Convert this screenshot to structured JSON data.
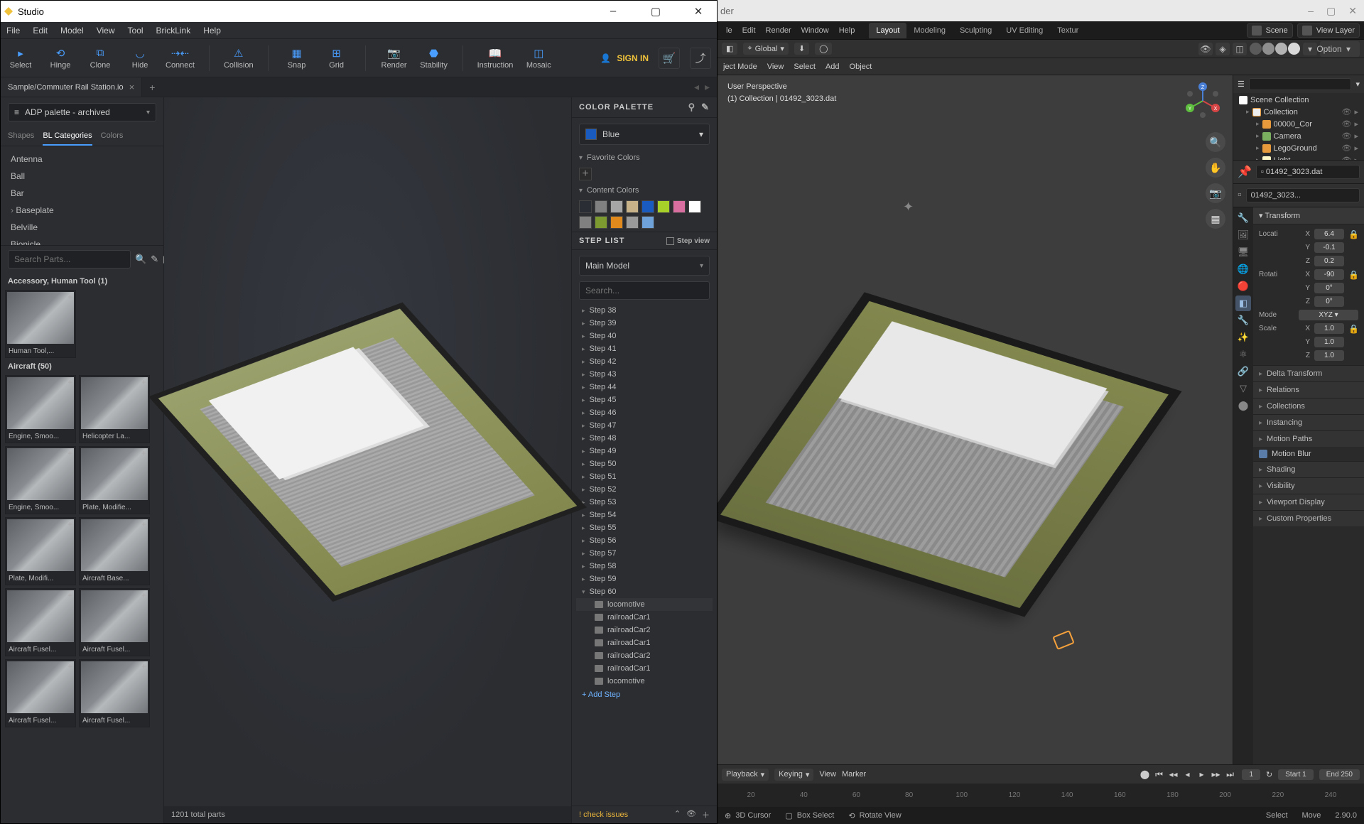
{
  "studio": {
    "title": "Studio",
    "menus": [
      "File",
      "Edit",
      "Model",
      "View",
      "Tool",
      "BrickLink",
      "Help"
    ],
    "toolbar": [
      {
        "id": "select",
        "label": "Select"
      },
      {
        "id": "hinge",
        "label": "Hinge"
      },
      {
        "id": "clone",
        "label": "Clone"
      },
      {
        "id": "hide",
        "label": "Hide"
      },
      {
        "id": "connect",
        "label": "Connect"
      },
      {
        "id": "collision",
        "label": "Collision"
      },
      {
        "id": "snap",
        "label": "Snap"
      },
      {
        "id": "grid",
        "label": "Grid"
      },
      {
        "id": "render",
        "label": "Render"
      },
      {
        "id": "stability",
        "label": "Stability"
      },
      {
        "id": "instruction",
        "label": "Instruction"
      },
      {
        "id": "mosaic",
        "label": "Mosaic"
      }
    ],
    "signin": "SIGN IN",
    "file_tab": "Sample/Commuter Rail Station.io",
    "palette": "ADP palette - archived",
    "cat_tabs": [
      "Shapes",
      "BL Categories",
      "Colors"
    ],
    "cat_tabs_active": 1,
    "categories": [
      "Antenna",
      "Ball",
      "Bar",
      "Baseplate",
      "Belville",
      "Bionicle"
    ],
    "search_placeholder": "Search Parts...",
    "sections": [
      {
        "title": "Accessory, Human Tool (1)",
        "items": [
          "Human Tool,..."
        ]
      },
      {
        "title": "Aircraft (50)",
        "items": [
          "Engine, Smoo...",
          "Helicopter La...",
          "Engine, Smoo...",
          "Plate, Modifie...",
          "Plate, Modifi...",
          "Aircraft Base...",
          "Aircraft Fusel...",
          "Aircraft Fusel...",
          "Aircraft Fusel...",
          "Aircraft Fusel..."
        ]
      }
    ],
    "status": "1201 total parts",
    "color_palette_hdr": "COLOR PALETTE",
    "current_color": {
      "name": "Blue",
      "hex": "#1a5bbf"
    },
    "favorite_hdr": "Favorite Colors",
    "content_hdr": "Content Colors",
    "content_colors": [
      "#2a2d33",
      "#808080",
      "#a6a6a6",
      "#c7b28a",
      "#1a5bbf",
      "#a7d129",
      "#d96fa1",
      "#ffffff",
      "#808080",
      "#7c9a2f",
      "#e08a1e",
      "#9a9a9a",
      "#6fa2d9"
    ],
    "steplist_hdr": "STEP LIST",
    "stepview": "Step view",
    "main_model": "Main Model",
    "step_search_placeholder": "Search...",
    "steps": [
      "Step 38",
      "Step 39",
      "Step 40",
      "Step 41",
      "Step 42",
      "Step 43",
      "Step 44",
      "Step 45",
      "Step 46",
      "Step 47",
      "Step 48",
      "Step 49",
      "Step 50",
      "Step 51",
      "Step 52",
      "Step 53",
      "Step 54",
      "Step 55",
      "Step 56",
      "Step 57",
      "Step 58",
      "Step 59",
      "Step 60"
    ],
    "substeps": [
      "locomotive",
      "railroadCar1",
      "railroadCar2",
      "railroadCar1",
      "railroadCar2",
      "railroadCar1",
      "locomotive"
    ],
    "add_step": "+ Add Step",
    "issues": "! check issues"
  },
  "blender": {
    "title": "der",
    "menus": [
      "le",
      "Edit",
      "Render",
      "Window",
      "Help"
    ],
    "workspaces": [
      "Layout",
      "Modeling",
      "Sculpting",
      "UV Editing",
      "Textur"
    ],
    "workspace_active": 0,
    "scene": "Scene",
    "viewlayer": "View Layer",
    "hdr": {
      "mode": "ject Mode",
      "view": "View",
      "select": "Select",
      "add": "Add",
      "object": "Object",
      "global": "Global",
      "options": "Options"
    },
    "persp1": "User Perspective",
    "persp2": "(1) Collection | 01492_3023.dat",
    "outliner": {
      "root": "Scene Collection",
      "items": [
        {
          "label": "Collection",
          "icon": "coll",
          "indent": 1
        },
        {
          "label": "00000_Cor",
          "icon": "mesh",
          "indent": 2
        },
        {
          "label": "Camera",
          "icon": "cam",
          "indent": 2
        },
        {
          "label": "LegoGround",
          "icon": "mesh",
          "indent": 2
        },
        {
          "label": "Light",
          "icon": "light",
          "indent": 2
        }
      ]
    },
    "active_file": "01492_3023.dat",
    "active_obj": "01492_3023...",
    "transform_hdr": "Transform",
    "transform": {
      "location": [
        "6.4",
        "-0.1",
        "0.2"
      ],
      "rotation": [
        "-90",
        "0°",
        "0°"
      ],
      "mode": "XYZ",
      "scale": [
        "1.0",
        "1.0",
        "1.0"
      ]
    },
    "panels": [
      "Delta Transform",
      "Relations",
      "Collections",
      "Instancing",
      "Motion Paths",
      "Motion Blur",
      "Shading",
      "Visibility",
      "Viewport Display",
      "Custom Properties"
    ],
    "timeline": {
      "playback": "Playback",
      "keying": "Keying",
      "view": "View",
      "marker": "Marker",
      "frame": "1",
      "start_label": "Start",
      "start": "1",
      "end_label": "End",
      "end": "250",
      "ticks": [
        "20",
        "40",
        "60",
        "80",
        "100",
        "120",
        "140",
        "160",
        "180",
        "200",
        "220",
        "240"
      ]
    },
    "status": {
      "items": [
        "3D Cursor",
        "Box Select",
        "Rotate View",
        "Select",
        "Move"
      ],
      "version": "2.90.0"
    }
  }
}
